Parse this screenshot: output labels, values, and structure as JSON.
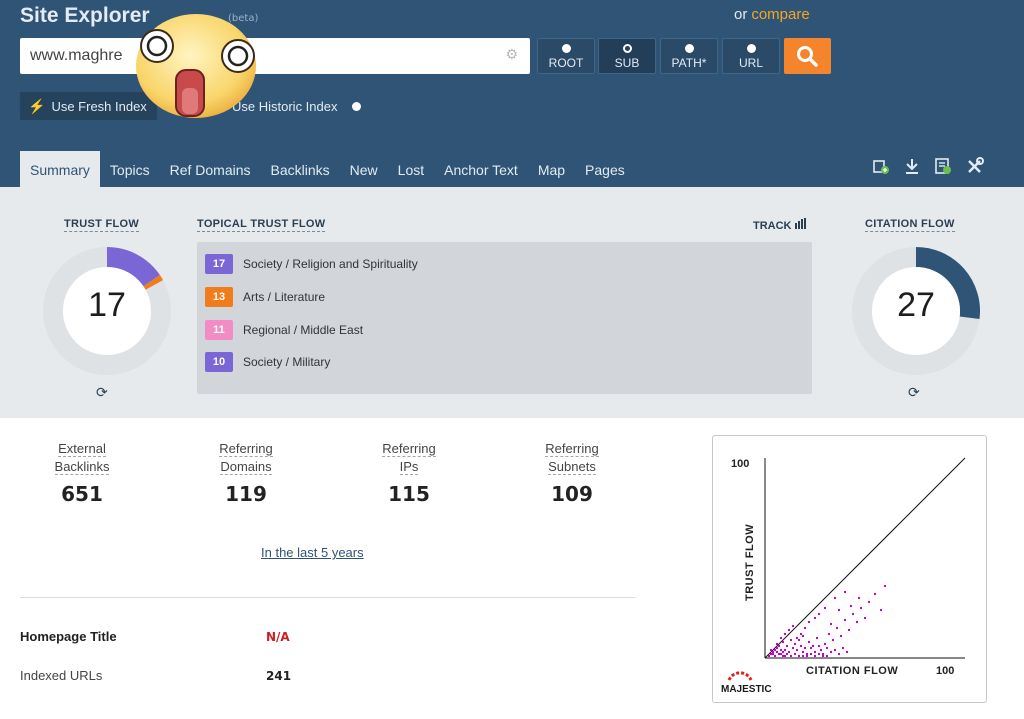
{
  "header": {
    "title": "Site Explorer",
    "title_suffix": "(beta)",
    "compare_prefix": "or",
    "compare_link": "compare",
    "search_value": "www.maghre",
    "scopes": [
      {
        "label": "ROOT",
        "selected": false
      },
      {
        "label": "SUB",
        "selected": true
      },
      {
        "label": "PATH*",
        "selected": false
      },
      {
        "label": "URL",
        "selected": false
      }
    ],
    "fresh_index_label": "Use Fresh Index",
    "historic_index_label": "Use Historic Index"
  },
  "tabs": [
    "Summary",
    "Topics",
    "Ref Domains",
    "Backlinks",
    "New",
    "Lost",
    "Anchor Text",
    "Map",
    "Pages"
  ],
  "active_tab": "Summary",
  "toolbar_icons": [
    "add-to-bucket-icon",
    "download-icon",
    "report-icon",
    "tools-icon"
  ],
  "trust_flow": {
    "label": "TRUST FLOW",
    "value": "17",
    "fraction": 0.17
  },
  "citation_flow": {
    "label": "CITATION FLOW",
    "value": "27",
    "fraction": 0.27
  },
  "topical_trust_flow": {
    "label": "TOPICAL TRUST FLOW",
    "track_label": "TRACK",
    "topics": [
      {
        "value": "17",
        "name": "Society / Religion and Spirituality",
        "color": "#7b66d6"
      },
      {
        "value": "13",
        "name": "Arts / Literature",
        "color": "#f07c1c"
      },
      {
        "value": "11",
        "name": "Regional / Middle East",
        "color": "#f28cc5"
      },
      {
        "value": "10",
        "name": "Society / Military",
        "color": "#7b66d6"
      }
    ]
  },
  "stats": [
    {
      "line1": "External",
      "line2": "Backlinks",
      "value": "651"
    },
    {
      "line1": "Referring",
      "line2": "Domains",
      "value": "119"
    },
    {
      "line1": "Referring",
      "line2": "IPs",
      "value": "115"
    },
    {
      "line1": "Referring",
      "line2": "Subnets",
      "value": "109"
    }
  ],
  "period_link": "In the last 5 years",
  "info": {
    "homepage_title_label": "Homepage Title",
    "homepage_title_value": "N/A",
    "indexed_urls_label": "Indexed URLs",
    "indexed_urls_value": "241"
  },
  "chart_data": {
    "type": "scatter",
    "xlabel": "CITATION FLOW",
    "ylabel": "TRUST FLOW",
    "x_max_label": "100",
    "y_max_label": "100",
    "xlim": [
      0,
      100
    ],
    "ylim": [
      0,
      100
    ],
    "brand": "MAJESTIC",
    "reference_line": "diagonal",
    "points": [
      [
        4,
        2
      ],
      [
        6,
        3
      ],
      [
        8,
        2
      ],
      [
        10,
        4
      ],
      [
        12,
        3
      ],
      [
        14,
        5
      ],
      [
        5,
        1
      ],
      [
        7,
        6
      ],
      [
        9,
        8
      ],
      [
        11,
        6
      ],
      [
        13,
        9
      ],
      [
        15,
        7
      ],
      [
        16,
        4
      ],
      [
        18,
        6
      ],
      [
        20,
        5
      ],
      [
        22,
        8
      ],
      [
        24,
        6
      ],
      [
        26,
        10
      ],
      [
        28,
        4
      ],
      [
        30,
        7
      ],
      [
        32,
        12
      ],
      [
        34,
        9
      ],
      [
        36,
        15
      ],
      [
        38,
        11
      ],
      [
        40,
        19
      ],
      [
        42,
        14
      ],
      [
        44,
        22
      ],
      [
        46,
        18
      ],
      [
        48,
        25
      ],
      [
        50,
        20
      ],
      [
        52,
        28
      ],
      [
        35,
        30
      ],
      [
        40,
        33
      ],
      [
        25,
        20
      ],
      [
        20,
        15
      ],
      [
        18,
        12
      ],
      [
        30,
        25
      ],
      [
        3,
        4
      ],
      [
        6,
        7
      ],
      [
        8,
        10
      ],
      [
        10,
        12
      ],
      [
        12,
        14
      ],
      [
        14,
        16
      ],
      [
        16,
        10
      ],
      [
        22,
        18
      ],
      [
        27,
        22
      ],
      [
        33,
        17
      ],
      [
        37,
        24
      ],
      [
        43,
        26
      ],
      [
        47,
        30
      ],
      [
        55,
        32
      ],
      [
        58,
        24
      ],
      [
        60,
        36
      ],
      [
        19,
        3
      ],
      [
        21,
        2
      ],
      [
        23,
        5
      ],
      [
        25,
        3
      ],
      [
        27,
        6
      ],
      [
        29,
        2
      ],
      [
        31,
        5
      ],
      [
        17,
        9
      ],
      [
        19,
        11
      ],
      [
        9,
        1
      ],
      [
        11,
        2
      ],
      [
        13,
        1
      ],
      [
        15,
        2
      ],
      [
        17,
        1
      ],
      [
        19,
        1
      ],
      [
        21,
        1
      ],
      [
        23,
        2
      ],
      [
        25,
        1
      ],
      [
        27,
        2
      ],
      [
        29,
        1
      ],
      [
        31,
        1
      ],
      [
        33,
        3
      ],
      [
        35,
        4
      ],
      [
        37,
        2
      ],
      [
        39,
        5
      ],
      [
        41,
        3
      ],
      [
        2,
        1
      ],
      [
        3,
        2
      ],
      [
        4,
        3
      ],
      [
        5,
        4
      ],
      [
        6,
        5
      ],
      [
        7,
        2
      ],
      [
        8,
        4
      ],
      [
        9,
        3
      ],
      [
        10,
        1
      ]
    ],
    "point_color": "#cc00cc"
  }
}
